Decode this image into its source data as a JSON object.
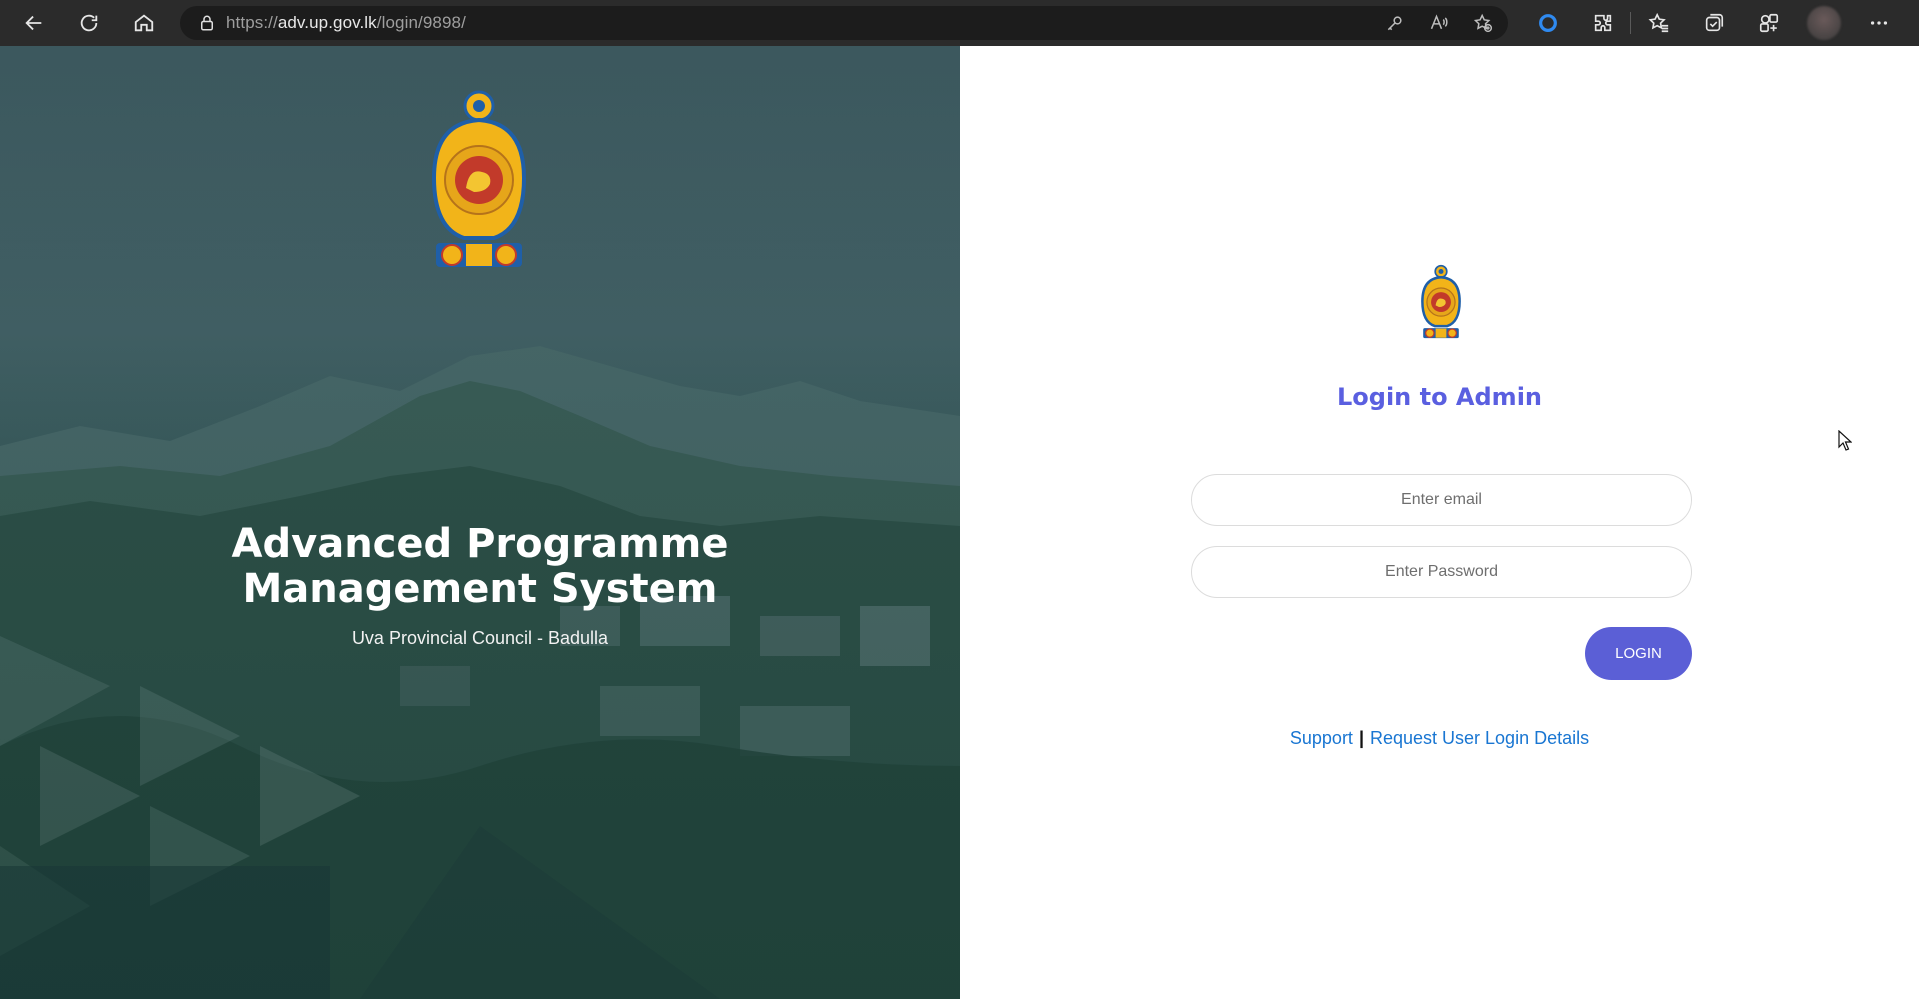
{
  "browser": {
    "url_prefix": "https://",
    "url_host": "adv.up.gov.lk",
    "url_path": "/login/9898/",
    "icons": [
      "back-icon",
      "reload-icon",
      "home-icon",
      "lock-icon",
      "key-icon",
      "read-aloud-icon",
      "add-favorite-icon",
      "copilot-icon",
      "extensions-icon",
      "favorites-icon",
      "collections-icon",
      "browser-essentials-icon",
      "profile-avatar",
      "more-icon"
    ]
  },
  "hero": {
    "title_line1": "Advanced Programme",
    "title_line2": "Management System",
    "subtitle": "Uva Provincial Council - Badulla"
  },
  "login": {
    "title": "Login to Admin",
    "email_placeholder": "Enter email",
    "password_placeholder": "Enter Password",
    "button_label": "LOGIN",
    "support_link": "Support",
    "separator": "|",
    "request_link": "Request User Login Details"
  },
  "colors": {
    "accent": "#5b5fd6",
    "title": "#5a5fe0",
    "link": "#1976d2",
    "chrome": "#2b2b2b"
  }
}
